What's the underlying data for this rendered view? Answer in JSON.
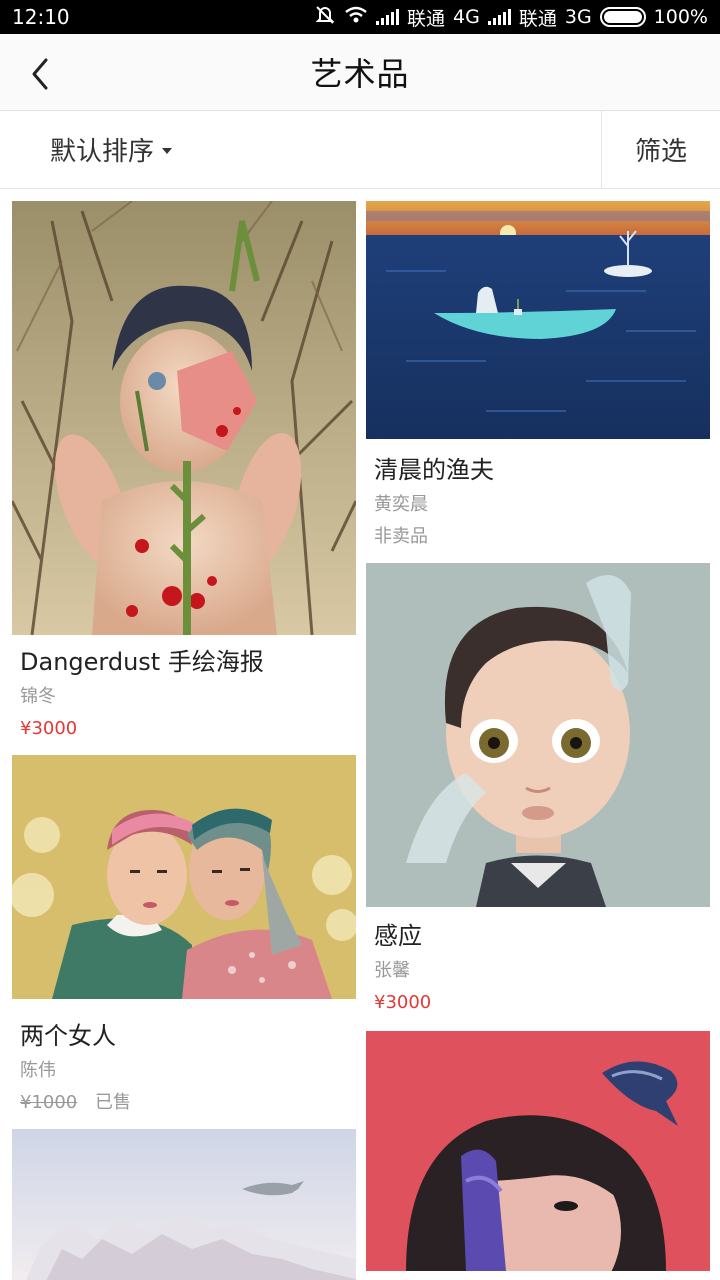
{
  "status_bar": {
    "time": "12:10",
    "carrier1": "联通",
    "network1": "4G",
    "carrier2": "联通",
    "network2": "3G",
    "battery": "100%"
  },
  "nav": {
    "title": "艺术品",
    "back_icon": "chevron-left-icon"
  },
  "filter_bar": {
    "sort_label": "默认排序",
    "filter_label": "筛选"
  },
  "colors": {
    "accent_price": "#e53935",
    "muted": "#999999"
  },
  "artworks": [
    {
      "title": "Dangerdust 手绘海报",
      "artist": "锦冬",
      "price": "¥3000"
    },
    {
      "title": "清晨的渔夫",
      "artist": "黄奕晨",
      "status": "非卖品"
    },
    {
      "title": "两个女人",
      "artist": "陈伟",
      "price": "¥1000",
      "status": "已售"
    },
    {
      "title": "感应",
      "artist": "张馨",
      "price": "¥3000"
    }
  ]
}
